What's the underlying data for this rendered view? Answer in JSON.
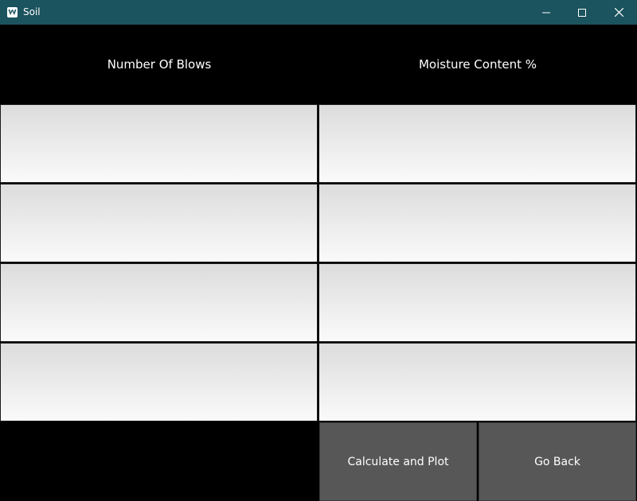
{
  "window": {
    "title": "Soil",
    "controls": {
      "minimize_icon": "minimize-icon",
      "maximize_icon": "maximize-icon",
      "close_icon": "close-icon"
    },
    "titlebar_color": "#1b535e"
  },
  "headers": {
    "blows": "Number Of Blows",
    "moisture": "Moisture Content %"
  },
  "inputs": {
    "blows": [
      "",
      "",
      "",
      ""
    ],
    "moisture": [
      "",
      "",
      "",
      ""
    ]
  },
  "buttons": {
    "calculate": "Calculate and Plot",
    "go_back": "Go Back"
  }
}
